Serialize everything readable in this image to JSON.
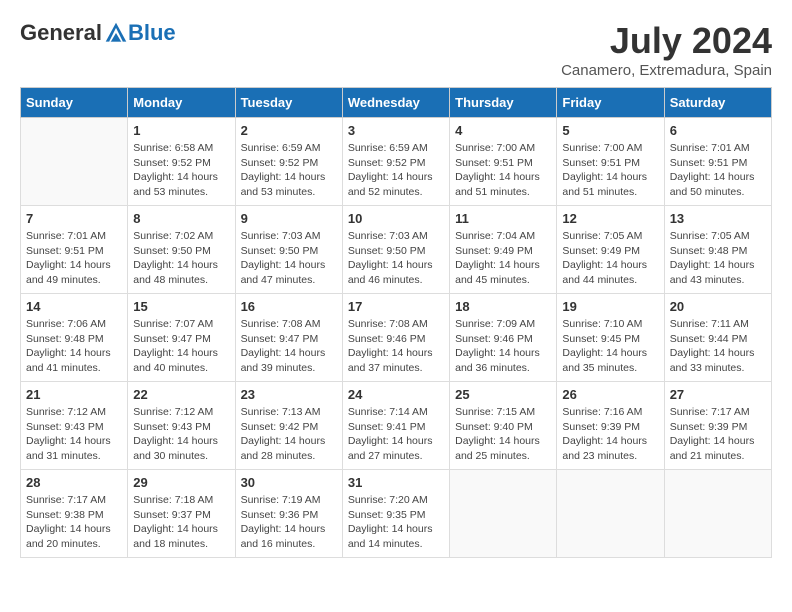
{
  "header": {
    "logo_general": "General",
    "logo_blue": "Blue",
    "month_year": "July 2024",
    "location": "Canamero, Extremadura, Spain"
  },
  "weekdays": [
    "Sunday",
    "Monday",
    "Tuesday",
    "Wednesday",
    "Thursday",
    "Friday",
    "Saturday"
  ],
  "weeks": [
    [
      {
        "day": "",
        "info": ""
      },
      {
        "day": "1",
        "info": "Sunrise: 6:58 AM\nSunset: 9:52 PM\nDaylight: 14 hours\nand 53 minutes."
      },
      {
        "day": "2",
        "info": "Sunrise: 6:59 AM\nSunset: 9:52 PM\nDaylight: 14 hours\nand 53 minutes."
      },
      {
        "day": "3",
        "info": "Sunrise: 6:59 AM\nSunset: 9:52 PM\nDaylight: 14 hours\nand 52 minutes."
      },
      {
        "day": "4",
        "info": "Sunrise: 7:00 AM\nSunset: 9:51 PM\nDaylight: 14 hours\nand 51 minutes."
      },
      {
        "day": "5",
        "info": "Sunrise: 7:00 AM\nSunset: 9:51 PM\nDaylight: 14 hours\nand 51 minutes."
      },
      {
        "day": "6",
        "info": "Sunrise: 7:01 AM\nSunset: 9:51 PM\nDaylight: 14 hours\nand 50 minutes."
      }
    ],
    [
      {
        "day": "7",
        "info": "Sunrise: 7:01 AM\nSunset: 9:51 PM\nDaylight: 14 hours\nand 49 minutes."
      },
      {
        "day": "8",
        "info": "Sunrise: 7:02 AM\nSunset: 9:50 PM\nDaylight: 14 hours\nand 48 minutes."
      },
      {
        "day": "9",
        "info": "Sunrise: 7:03 AM\nSunset: 9:50 PM\nDaylight: 14 hours\nand 47 minutes."
      },
      {
        "day": "10",
        "info": "Sunrise: 7:03 AM\nSunset: 9:50 PM\nDaylight: 14 hours\nand 46 minutes."
      },
      {
        "day": "11",
        "info": "Sunrise: 7:04 AM\nSunset: 9:49 PM\nDaylight: 14 hours\nand 45 minutes."
      },
      {
        "day": "12",
        "info": "Sunrise: 7:05 AM\nSunset: 9:49 PM\nDaylight: 14 hours\nand 44 minutes."
      },
      {
        "day": "13",
        "info": "Sunrise: 7:05 AM\nSunset: 9:48 PM\nDaylight: 14 hours\nand 43 minutes."
      }
    ],
    [
      {
        "day": "14",
        "info": "Sunrise: 7:06 AM\nSunset: 9:48 PM\nDaylight: 14 hours\nand 41 minutes."
      },
      {
        "day": "15",
        "info": "Sunrise: 7:07 AM\nSunset: 9:47 PM\nDaylight: 14 hours\nand 40 minutes."
      },
      {
        "day": "16",
        "info": "Sunrise: 7:08 AM\nSunset: 9:47 PM\nDaylight: 14 hours\nand 39 minutes."
      },
      {
        "day": "17",
        "info": "Sunrise: 7:08 AM\nSunset: 9:46 PM\nDaylight: 14 hours\nand 37 minutes."
      },
      {
        "day": "18",
        "info": "Sunrise: 7:09 AM\nSunset: 9:46 PM\nDaylight: 14 hours\nand 36 minutes."
      },
      {
        "day": "19",
        "info": "Sunrise: 7:10 AM\nSunset: 9:45 PM\nDaylight: 14 hours\nand 35 minutes."
      },
      {
        "day": "20",
        "info": "Sunrise: 7:11 AM\nSunset: 9:44 PM\nDaylight: 14 hours\nand 33 minutes."
      }
    ],
    [
      {
        "day": "21",
        "info": "Sunrise: 7:12 AM\nSunset: 9:43 PM\nDaylight: 14 hours\nand 31 minutes."
      },
      {
        "day": "22",
        "info": "Sunrise: 7:12 AM\nSunset: 9:43 PM\nDaylight: 14 hours\nand 30 minutes."
      },
      {
        "day": "23",
        "info": "Sunrise: 7:13 AM\nSunset: 9:42 PM\nDaylight: 14 hours\nand 28 minutes."
      },
      {
        "day": "24",
        "info": "Sunrise: 7:14 AM\nSunset: 9:41 PM\nDaylight: 14 hours\nand 27 minutes."
      },
      {
        "day": "25",
        "info": "Sunrise: 7:15 AM\nSunset: 9:40 PM\nDaylight: 14 hours\nand 25 minutes."
      },
      {
        "day": "26",
        "info": "Sunrise: 7:16 AM\nSunset: 9:39 PM\nDaylight: 14 hours\nand 23 minutes."
      },
      {
        "day": "27",
        "info": "Sunrise: 7:17 AM\nSunset: 9:39 PM\nDaylight: 14 hours\nand 21 minutes."
      }
    ],
    [
      {
        "day": "28",
        "info": "Sunrise: 7:17 AM\nSunset: 9:38 PM\nDaylight: 14 hours\nand 20 minutes."
      },
      {
        "day": "29",
        "info": "Sunrise: 7:18 AM\nSunset: 9:37 PM\nDaylight: 14 hours\nand 18 minutes."
      },
      {
        "day": "30",
        "info": "Sunrise: 7:19 AM\nSunset: 9:36 PM\nDaylight: 14 hours\nand 16 minutes."
      },
      {
        "day": "31",
        "info": "Sunrise: 7:20 AM\nSunset: 9:35 PM\nDaylight: 14 hours\nand 14 minutes."
      },
      {
        "day": "",
        "info": ""
      },
      {
        "day": "",
        "info": ""
      },
      {
        "day": "",
        "info": ""
      }
    ]
  ]
}
